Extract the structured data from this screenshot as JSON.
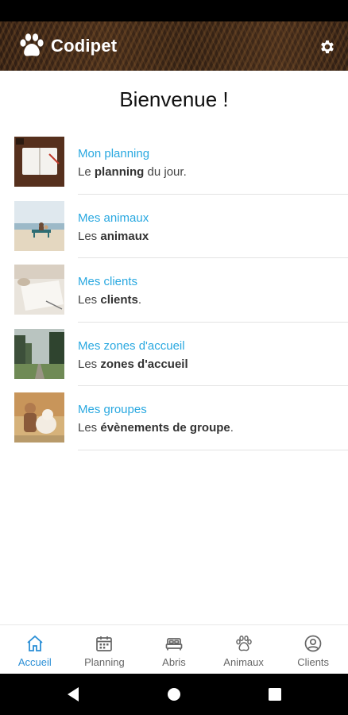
{
  "app": {
    "title": "Codipet"
  },
  "welcome": "Bienvenue !",
  "menu": [
    {
      "title": "Mon planning",
      "desc_pre": "Le ",
      "desc_bold": "planning",
      "desc_post": " du jour.",
      "image": "notebook-photo"
    },
    {
      "title": "Mes animaux",
      "desc_pre": "Les ",
      "desc_bold": "animaux",
      "desc_post": "",
      "image": "beach-bench-photo"
    },
    {
      "title": "Mes clients",
      "desc_pre": "Les ",
      "desc_bold": "clients",
      "desc_post": ".",
      "image": "desk-paper-photo"
    },
    {
      "title": "Mes zones d'accueil",
      "desc_pre": "Les ",
      "desc_bold": "zones d'accueil",
      "desc_post": "",
      "image": "forest-path-photo"
    },
    {
      "title": "Mes groupes",
      "desc_pre": "Les ",
      "desc_bold": "évènements de groupe",
      "desc_post": ".",
      "image": "woman-dog-photo"
    }
  ],
  "bottom_nav": [
    {
      "label": "Accueil",
      "icon": "home-icon",
      "active": true
    },
    {
      "label": "Planning",
      "icon": "calendar-icon",
      "active": false
    },
    {
      "label": "Abris",
      "icon": "bed-icon",
      "active": false
    },
    {
      "label": "Animaux",
      "icon": "paw-icon",
      "active": false
    },
    {
      "label": "Clients",
      "icon": "account-icon",
      "active": false
    }
  ],
  "colors": {
    "accent": "#2b8fd6",
    "item_title": "#29a8e0",
    "nav_inactive": "#666666"
  }
}
